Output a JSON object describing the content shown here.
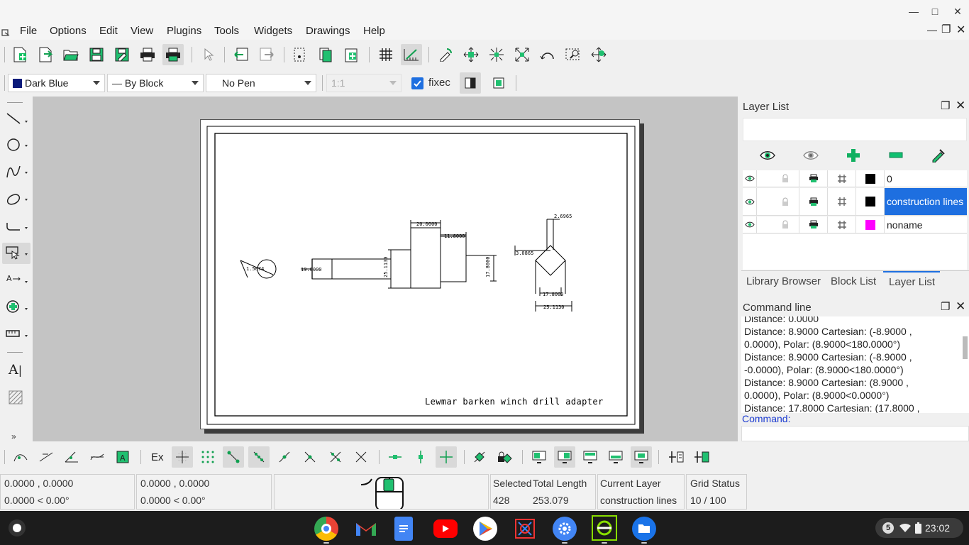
{
  "window": {
    "minimize": "—",
    "maximize": "□",
    "close": "✕"
  },
  "menubar": {
    "items": [
      "File",
      "Options",
      "Edit",
      "View",
      "Plugins",
      "Tools",
      "Widgets",
      "Drawings",
      "Help"
    ]
  },
  "property_toolbar": {
    "color": "Dark Blue",
    "color_hex": "#0a1a7a",
    "line_type": "— By Block",
    "pen": "No Pen",
    "scale": "1:1",
    "fixed_label": "fixec"
  },
  "drawing": {
    "dims": {
      "d1": "20.0000",
      "d2": "11.8000",
      "d3": "19.0000",
      "d4": "25.1130",
      "d5": "17.8000",
      "d6": "1.5074",
      "d7": "2.6965",
      "d8": "3.0865",
      "d9": "17.8000",
      "d10": "25.1130"
    },
    "title_text": "Lewmar barken winch drill adapter"
  },
  "layer_list": {
    "title": "Layer List",
    "layers": [
      {
        "name": "0",
        "color": "#000000",
        "selected": false
      },
      {
        "name": "construction lines",
        "color": "#000000",
        "selected": true
      },
      {
        "name": "noname",
        "color": "#ff00ff",
        "selected": false
      }
    ],
    "tabs": [
      "Library Browser",
      "Block List",
      "Layer List"
    ],
    "active_tab": "Layer List"
  },
  "command_line": {
    "title": "Command line",
    "log": [
      "Distance: 0.0000",
      "Distance: 8.9000 Cartesian: (-8.9000 ,",
      "0.0000), Polar: (8.9000<180.0000°)",
      "Distance: 8.9000 Cartesian: (-8.9000 ,",
      "-0.0000), Polar: (8.9000<180.0000°)",
      "Distance: 8.9000 Cartesian: (8.9000 ,",
      "0.0000), Polar: (8.9000<0.0000°)",
      "Distance: 17.8000 Cartesian: (17.8000 ,"
    ],
    "prompt": "Command:",
    "input_value": ""
  },
  "snap_toolbar": {
    "ex_label": "Ex"
  },
  "status": {
    "abs_coord": "0.0000 , 0.0000",
    "abs_polar": "0.0000 < 0.00°",
    "rel_coord": "0.0000 , 0.0000",
    "rel_polar": "0.0000 < 0.00°",
    "selected_label": "Selected",
    "selected_value": "428",
    "total_length_label": "Total Length",
    "total_length_value": "253.079",
    "current_layer_label": "Current Layer",
    "current_layer_value": "construction lines",
    "grid_status_label": "Grid Status",
    "grid_status_value": "10 / 100"
  },
  "taskbar": {
    "apps": [
      "chrome",
      "gmail",
      "docs",
      "youtube",
      "play-store",
      "librecad",
      "settings",
      "screen-recorder",
      "files"
    ],
    "notification_count": "5",
    "time": "23:02"
  }
}
